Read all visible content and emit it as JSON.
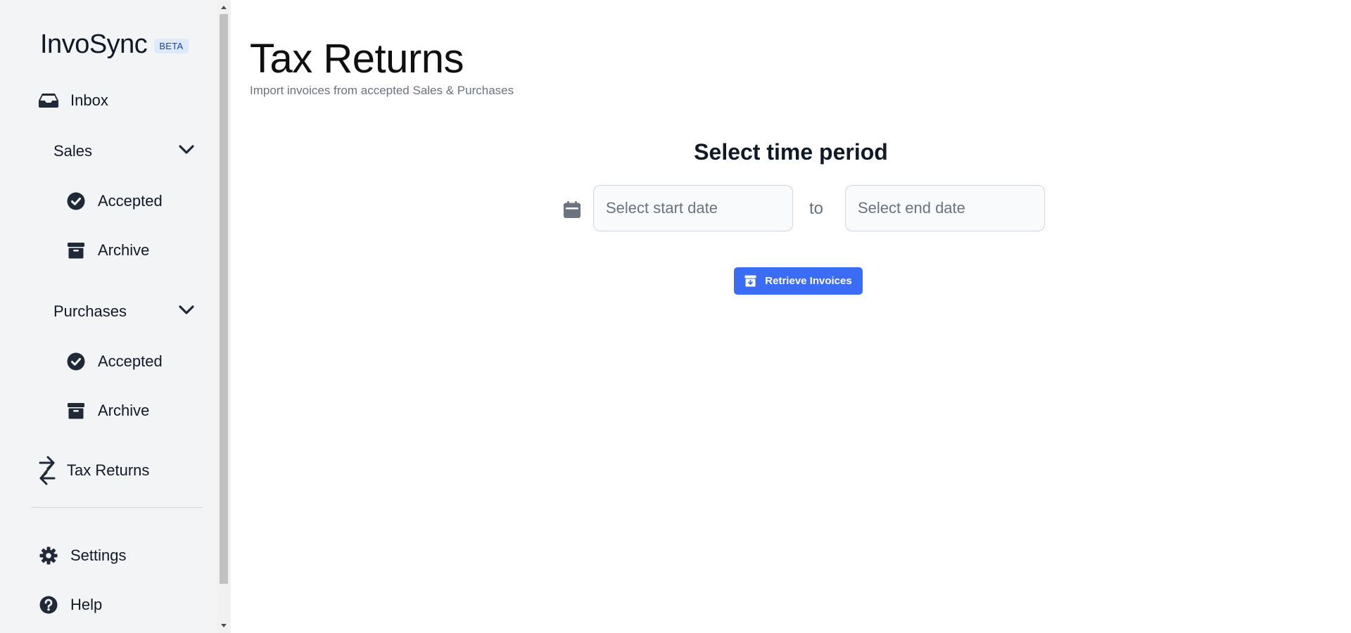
{
  "sidebar": {
    "brand_name": "InvoSync",
    "brand_badge": "BETA",
    "inbox": {
      "label": "Inbox",
      "icon": "inbox-icon"
    },
    "sales": {
      "label": "Sales",
      "items": [
        {
          "label": "Accepted",
          "icon": "check-circle-icon"
        },
        {
          "label": "Archive",
          "icon": "archive-box-icon"
        }
      ]
    },
    "purchases": {
      "label": "Purchases",
      "items": [
        {
          "label": "Accepted",
          "icon": "check-circle-icon"
        },
        {
          "label": "Archive",
          "icon": "archive-box-icon"
        }
      ]
    },
    "tax_returns": {
      "label": "Tax Returns",
      "icon": "arrows-right-left-icon"
    },
    "settings": {
      "label": "Settings",
      "icon": "gear-icon"
    },
    "help": {
      "label": "Help",
      "icon": "question-circle-icon"
    }
  },
  "main": {
    "title": "Tax Returns",
    "subtitle": "Import invoices from accepted Sales & Purchases",
    "period_heading": "Select time period",
    "start_date": {
      "placeholder": "Select start date",
      "value": ""
    },
    "to_label": "to",
    "end_date": {
      "placeholder": "Select end date",
      "value": ""
    },
    "retrieve_button": "Retrieve Invoices"
  },
  "colors": {
    "sidebar_bg": "#f3f4f6",
    "accent": "#3b6cf6",
    "badge_bg": "#dbeafe",
    "badge_text": "#1e40af"
  }
}
